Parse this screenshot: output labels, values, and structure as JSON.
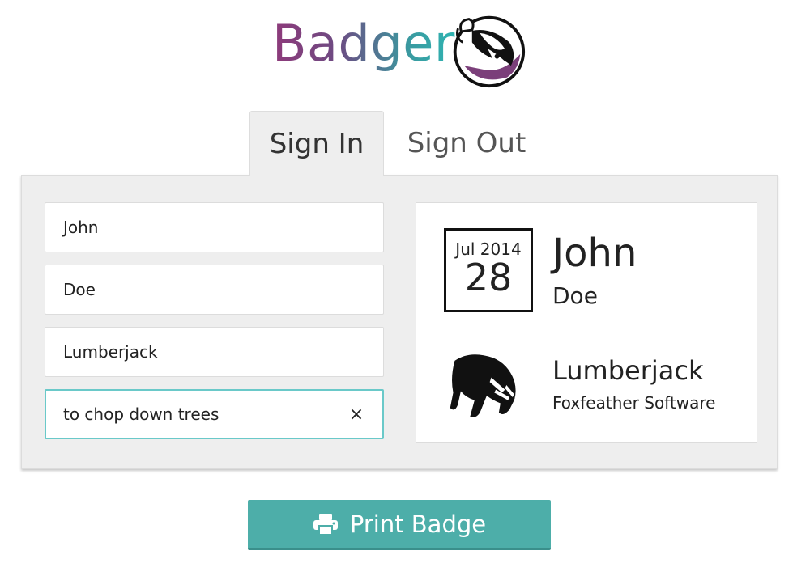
{
  "app": {
    "brand_name": "Badger",
    "logo_icon": "badger-logo-icon",
    "brand_colors": [
      "#8e3a7a",
      "#2eb4b2"
    ]
  },
  "tabs": [
    {
      "label": "Sign In",
      "active": true
    },
    {
      "label": "Sign Out",
      "active": false
    }
  ],
  "form": {
    "first_name": "John",
    "last_name": "Doe",
    "role": "Lumberjack",
    "purpose": "to chop down trees",
    "clear_glyph": "×"
  },
  "badge": {
    "month_year": "Jul 2014",
    "day": "28",
    "first_name": "John",
    "last_name": "Doe",
    "role": "Lumberjack",
    "company": "Foxfeather Software",
    "avatar_icon": "badger-silhouette-icon"
  },
  "actions": {
    "print_label": "Print Badge",
    "print_icon": "printer-icon",
    "accent_color": "#4daea9"
  }
}
